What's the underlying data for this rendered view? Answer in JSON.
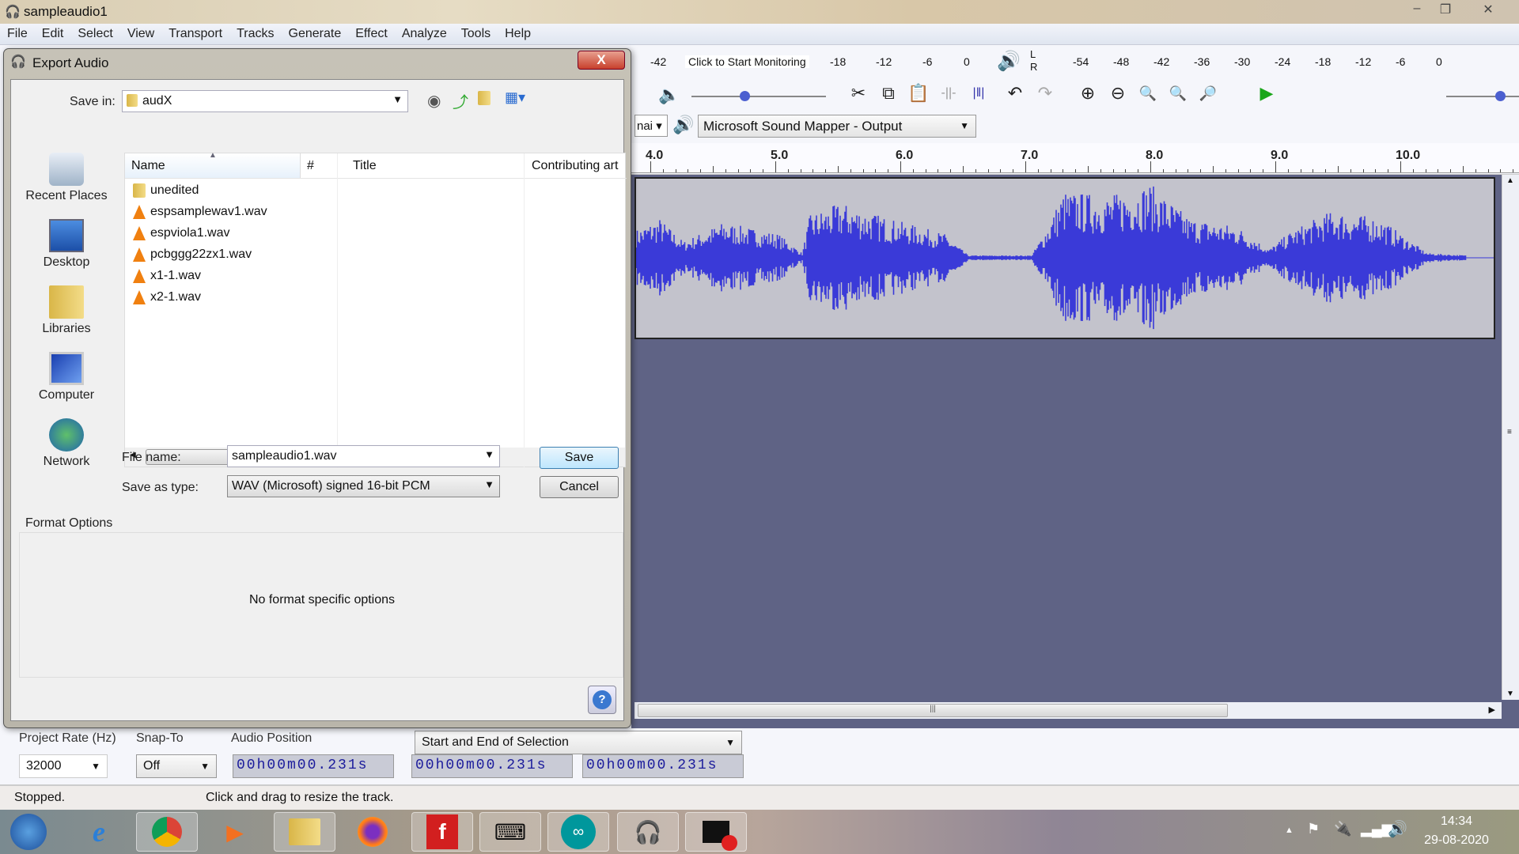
{
  "app": {
    "title": "sampleaudio1",
    "menu": [
      "File",
      "Edit",
      "Select",
      "View",
      "Transport",
      "Tracks",
      "Generate",
      "Effect",
      "Analyze",
      "Tools",
      "Help"
    ]
  },
  "toolbar": {
    "rec_meter_ticks": [
      "-42",
      "-18",
      "-12",
      "-6",
      "0"
    ],
    "monitor_label": "Click to Start Monitoring",
    "play_meter_ticks": [
      "-54",
      "-48",
      "-42",
      "-36",
      "-30",
      "-24",
      "-18",
      "-12",
      "-6",
      "0"
    ],
    "lr": [
      "L",
      "R"
    ],
    "output_device": "Microsoft Sound Mapper - Output",
    "host_partial": "nai"
  },
  "timeline": {
    "ticks": [
      "4.0",
      "5.0",
      "6.0",
      "7.0",
      "8.0",
      "9.0",
      "10.0"
    ]
  },
  "colors": {
    "waveform": "#3a3ad8",
    "track_bg": "#c3c3cc",
    "workspace": "#5f6385"
  },
  "selection_bar": {
    "project_rate_label": "Project Rate (Hz)",
    "project_rate": "32000",
    "snap_label": "Snap-To",
    "snap_value": "Off",
    "audio_position_label": "Audio Position",
    "audio_position": "00h00m00.231s",
    "selection_label": "Start and End of Selection",
    "selection_start": "00h00m00.231s",
    "selection_end": "00h00m00.231s"
  },
  "status": {
    "state": "Stopped.",
    "hint": "Click and drag to resize the track."
  },
  "dialog": {
    "title": "Export Audio",
    "save_in_label": "Save in:",
    "save_in": "audX",
    "places": [
      "Recent Places",
      "Desktop",
      "Libraries",
      "Computer",
      "Network"
    ],
    "columns": [
      "Name",
      "#",
      "Title",
      "Contributing art"
    ],
    "files": [
      {
        "name": "unedited",
        "type": "folder"
      },
      {
        "name": "espsamplewav1.wav",
        "type": "wav"
      },
      {
        "name": "espviola1.wav",
        "type": "wav"
      },
      {
        "name": "pcbggg22zx1.wav",
        "type": "wav"
      },
      {
        "name": "x1-1.wav",
        "type": "wav"
      },
      {
        "name": "x2-1.wav",
        "type": "wav"
      }
    ],
    "file_name_label": "File name:",
    "file_name": "sampleaudio1.wav",
    "save_type_label": "Save as type:",
    "save_type": "WAV (Microsoft) signed 16-bit PCM",
    "save_button": "Save",
    "cancel_button": "Cancel",
    "format_options_label": "Format Options",
    "format_options_text": "No format specific options",
    "help": "?",
    "close": "X"
  },
  "taskbar": {
    "apps": [
      "start",
      "internet-explorer",
      "chrome",
      "media-player",
      "file-explorer",
      "firefox",
      "foxit",
      "on-screen-keyboard",
      "arduino",
      "audacity",
      "screen-recorder"
    ],
    "time": "14:34",
    "date": "29-08-2020"
  }
}
